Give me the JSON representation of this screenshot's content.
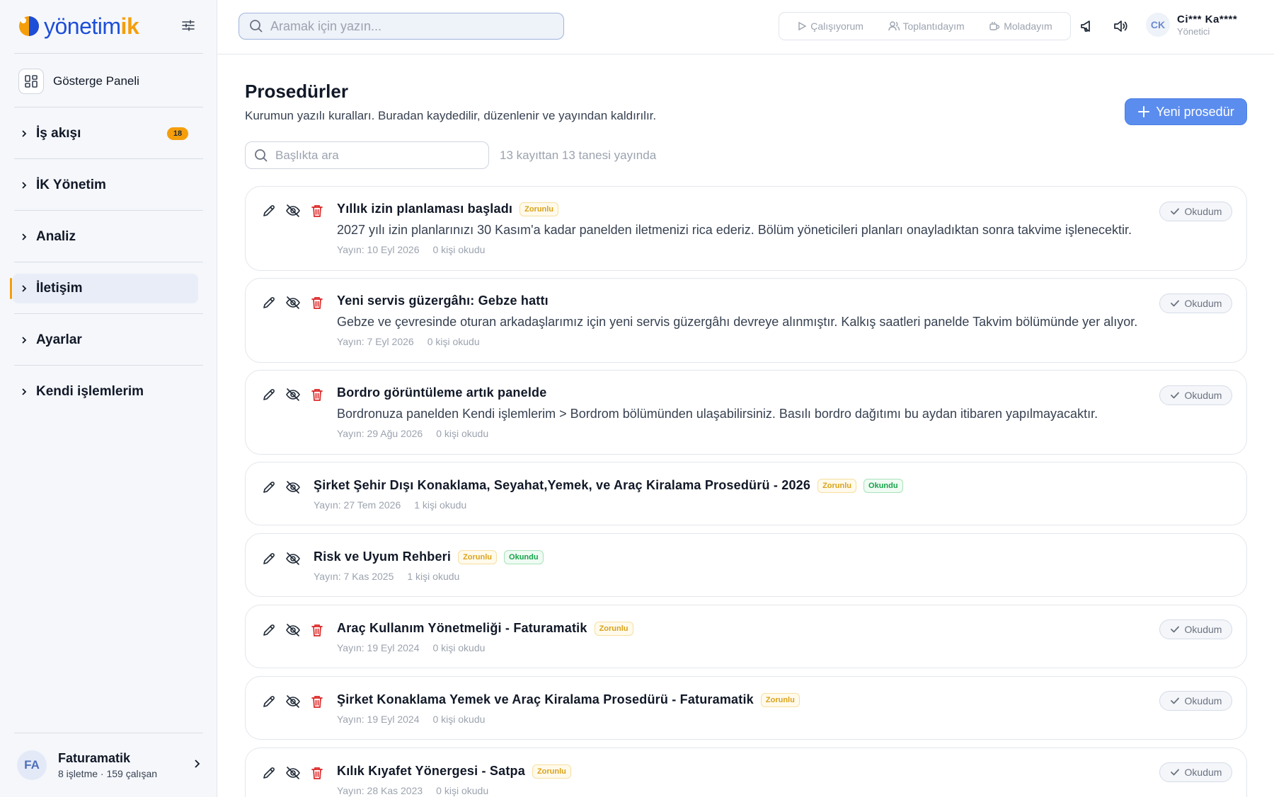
{
  "brand": {
    "name": "yönetim",
    "accent": "ik",
    "accent_color": "#f59e0b",
    "primary_color": "#1d4ed8"
  },
  "sidebar": {
    "dashboard_label": "Gösterge Paneli",
    "items": [
      {
        "label": "İş akışı",
        "badge": "18"
      },
      {
        "label": "İK Yönetim"
      },
      {
        "label": "Analiz"
      },
      {
        "label": "İletişim",
        "active": true
      },
      {
        "label": "Ayarlar"
      },
      {
        "label": "Kendi işlemlerim"
      }
    ],
    "org": {
      "initials": "FA",
      "name": "Faturamatik",
      "meta": "8 işletme · 159 çalışan"
    }
  },
  "topbar": {
    "search_placeholder": "Aramak için yazın...",
    "status": [
      {
        "label": "Çalışıyorum",
        "icon": "play-icon"
      },
      {
        "label": "Toplantıdayım",
        "icon": "users-icon"
      },
      {
        "label": "Moladayım",
        "icon": "coffee-icon"
      }
    ],
    "user": {
      "initials": "CK",
      "name": "Ci*** Ka****",
      "role": "Yönetici"
    }
  },
  "page": {
    "title": "Prosedürler",
    "subtitle": "Kurumun yazılı kuralları. Buradan kaydedilir, düzenlenir ve yayından kaldırılır.",
    "new_button": "Yeni prosedür",
    "filter_placeholder": "Başlıkta ara",
    "count_text": "13 kayıttan 13 tanesi yayında"
  },
  "labels": {
    "required": "Zorunlu",
    "read": "Okundu",
    "mark_read": "Okudum"
  },
  "procedures": [
    {
      "title": "Yıllık izin planlaması başladı",
      "required": true,
      "read": false,
      "deletable": true,
      "description": "2027 yılı izin planlarınızı 30 Kasım'a kadar panelden iletmenizi rica ederiz. Bölüm yöneticileri planları onayladıktan sonra takvime işlenecektir.",
      "published": "Yayın: 10 Eyl 2026",
      "readers": "0 kişi okudu"
    },
    {
      "title": "Yeni servis güzergâhı: Gebze hattı",
      "required": false,
      "read": false,
      "deletable": true,
      "description": "Gebze ve çevresinde oturan arkadaşlarımız için yeni servis güzergâhı devreye alınmıştır. Kalkış saatleri panelde Takvim bölümünde yer alıyor.",
      "published": "Yayın: 7 Eyl 2026",
      "readers": "0 kişi okudu"
    },
    {
      "title": "Bordro görüntüleme artık panelde",
      "required": false,
      "read": false,
      "deletable": true,
      "description": "Bordronuza panelden Kendi işlemlerim > Bordrom bölümünden ulaşabilirsiniz. Basılı bordro dağıtımı bu aydan itibaren yapılmayacaktır.",
      "published": "Yayın: 29 Ağu 2026",
      "readers": "0 kişi okudu"
    },
    {
      "title": "Şirket Şehir Dışı Konaklama, Seyahat,Yemek, ve Araç Kiralama Prosedürü - 2026",
      "required": true,
      "read": true,
      "deletable": false,
      "description": "",
      "published": "Yayın: 27 Tem 2026",
      "readers": "1 kişi okudu"
    },
    {
      "title": "Risk ve Uyum Rehberi",
      "required": true,
      "read": true,
      "deletable": false,
      "description": "",
      "published": "Yayın: 7 Kas 2025",
      "readers": "1 kişi okudu"
    },
    {
      "title": "Araç Kullanım Yönetmeliği - Faturamatik",
      "required": true,
      "read": false,
      "deletable": true,
      "description": "",
      "published": "Yayın: 19 Eyl 2024",
      "readers": "0 kişi okudu"
    },
    {
      "title": "Şirket Konaklama Yemek ve Araç Kiralama Prosedürü - Faturamatik",
      "required": true,
      "read": false,
      "deletable": true,
      "description": "",
      "published": "Yayın: 19 Eyl 2024",
      "readers": "0 kişi okudu"
    },
    {
      "title": "Kılık Kıyafet Yönergesi - Satpa",
      "required": true,
      "read": false,
      "deletable": true,
      "description": "",
      "published": "Yayın: 28 Kas 2023",
      "readers": "0 kişi okudu"
    }
  ]
}
